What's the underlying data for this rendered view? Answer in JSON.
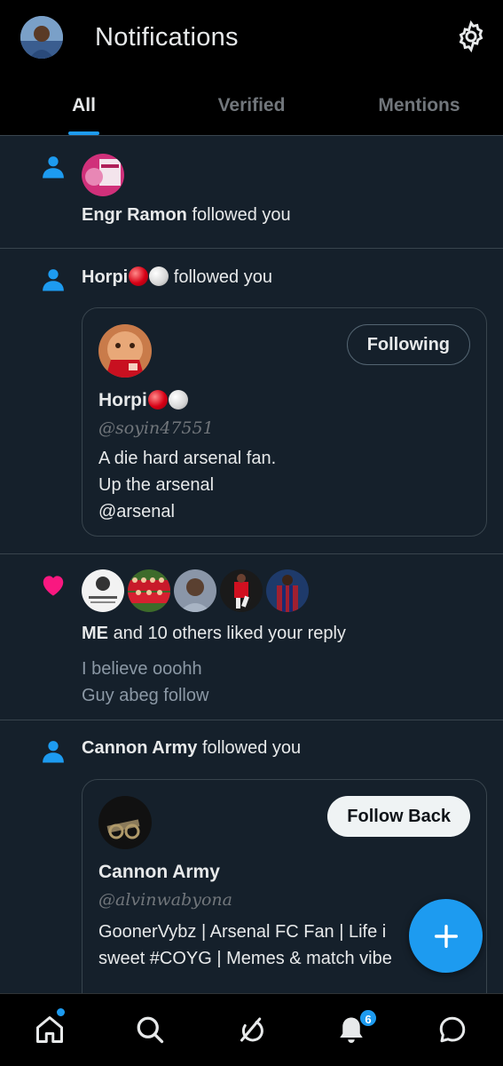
{
  "header": {
    "title": "Notifications"
  },
  "tabs": [
    {
      "label": "All",
      "active": true
    },
    {
      "label": "Verified",
      "active": false
    },
    {
      "label": "Mentions",
      "active": false
    }
  ],
  "notifications": [
    {
      "type": "follow",
      "user": "Engr Ramon",
      "action": "followed you"
    },
    {
      "type": "follow",
      "user": "Horpi",
      "action": "followed you",
      "card": {
        "name": "Horpi",
        "handle": "@soyin47551",
        "bio": "A die hard arsenal fan.\nUp the arsenal\n@arsenal",
        "button": "Following"
      }
    },
    {
      "type": "like",
      "user": "ME",
      "action": "and 10 others liked your reply",
      "reply_text": "I believe ooohh\nGuy abeg follow"
    },
    {
      "type": "follow",
      "user": "Cannon Army",
      "action": "followed you",
      "card": {
        "name": "Cannon Army",
        "handle": "@alvinwabyona",
        "bio": "GoonerVybz | Arsenal FC Fan | Life i\nsweet  #COYG | Memes & match vibe",
        "button": "Follow Back"
      }
    }
  ],
  "bottom_nav": {
    "items": [
      "home-icon",
      "search-icon",
      "grok-icon",
      "bell-icon",
      "messages-icon"
    ],
    "notification_count": "6"
  },
  "colors": {
    "accent": "#1d9bf0",
    "like": "#f91880",
    "background": "#15202b"
  }
}
